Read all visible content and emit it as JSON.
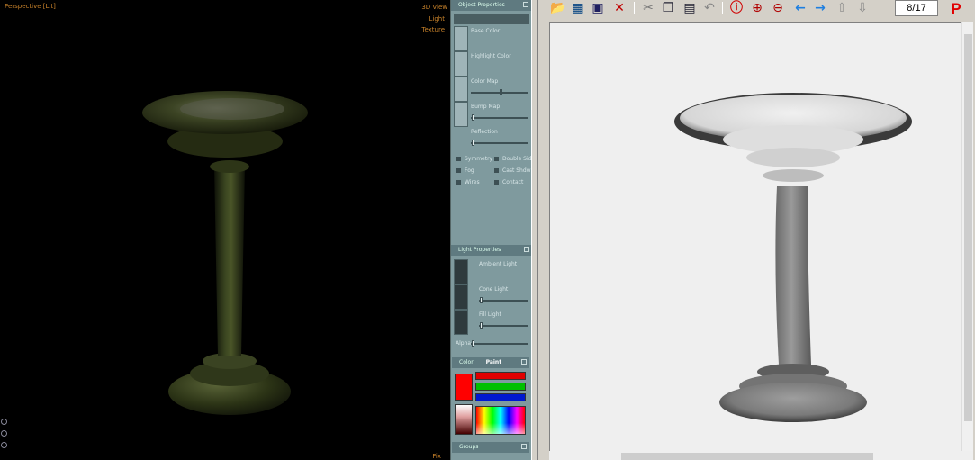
{
  "viewport": {
    "title": "Perspective [Lit]",
    "option_top": "3D View",
    "option_light": "Light",
    "option_texture": "Texture",
    "corner_label": "Fix"
  },
  "properties": {
    "header": "Object Properties",
    "rows": [
      {
        "label": "Base Color"
      },
      {
        "label": "Highlight Color"
      },
      {
        "label": "Color Map"
      },
      {
        "label": "Bump Map"
      },
      {
        "label": "Reflection"
      }
    ],
    "checks_left": [
      "Symmetry",
      "Fog",
      "Wires"
    ],
    "checks_right": [
      "Double Sided",
      "Cast Shdw",
      "Contact"
    ],
    "light_header": "Light Properties",
    "light_rows": [
      {
        "label": "Ambient Light"
      },
      {
        "label": "Cone Light"
      },
      {
        "label": "Fill Light"
      }
    ],
    "light_footer": "Alpha",
    "color_header": "Color",
    "paint_tab": "Paint",
    "groups_header": "Groups",
    "colors": {
      "selected": "#ff0000",
      "panel": "#7f9a9e"
    }
  },
  "viewer": {
    "page_indicator": "8/17",
    "toolbar_icons": [
      "open-folder-icon",
      "film-strip-icon",
      "save-disk-icon",
      "delete-x-icon",
      "cut-scissors-icon",
      "copy-icon",
      "paste-icon",
      "undo-icon",
      "info-icon",
      "zoom-in-icon",
      "zoom-out-icon",
      "arrow-left-icon",
      "arrow-right-icon",
      "arrow-up-icon",
      "arrow-down-icon",
      "p-logo-icon"
    ]
  }
}
